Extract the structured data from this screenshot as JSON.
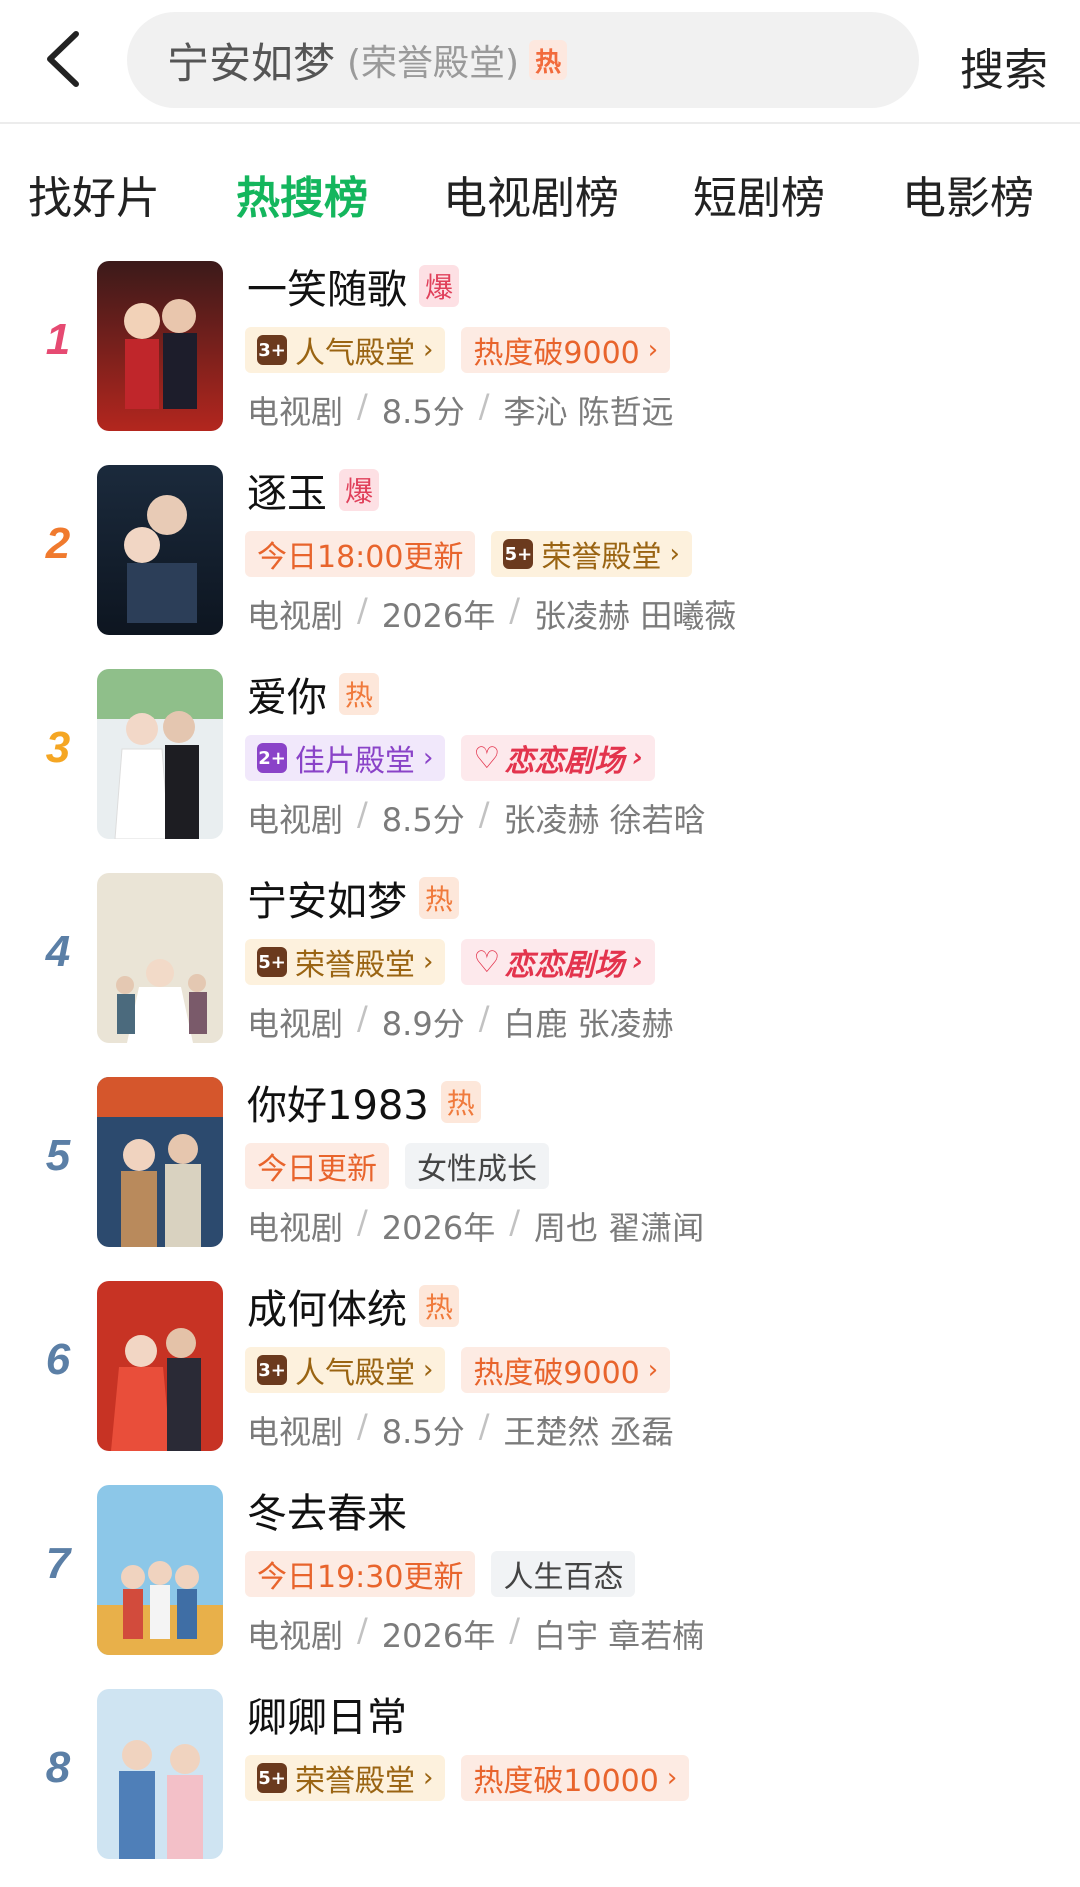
{
  "search": {
    "query": "宁安如梦",
    "query_sub": "(荣誉殿堂)",
    "hot_tag": "热",
    "submit_label": "搜索"
  },
  "tabs": [
    {
      "label": "找好片",
      "active": false
    },
    {
      "label": "热搜榜",
      "active": true
    },
    {
      "label": "电视剧榜",
      "active": false
    },
    {
      "label": "短剧榜",
      "active": false
    },
    {
      "label": "电影榜",
      "active": false
    }
  ],
  "colors": {
    "accent_green": "#14b65d",
    "rank_1": "#e64a72",
    "rank_2": "#f07a2e",
    "rank_3": "#f5a623",
    "rank_other": "#5b7fa6"
  },
  "list": [
    {
      "rank": "1",
      "title": "一笑随歌",
      "tag": "爆",
      "badges": [
        {
          "icon": "3+",
          "text": "人气殿堂",
          "arrow": "›"
        },
        {
          "icon": "",
          "text": "热度破9000",
          "arrow": "›"
        }
      ],
      "meta": {
        "type": "电视剧",
        "info": "8.5分",
        "cast": "李沁 陈哲远"
      }
    },
    {
      "rank": "2",
      "title": "逐玉",
      "tag": "爆",
      "badges": [
        {
          "icon": "",
          "text": "今日18:00更新",
          "arrow": ""
        },
        {
          "icon": "5+",
          "text": "荣誉殿堂",
          "arrow": "›"
        }
      ],
      "meta": {
        "type": "电视剧",
        "info": "2026年",
        "cast": "张凌赫 田曦薇"
      }
    },
    {
      "rank": "3",
      "title": "爱你",
      "tag": "热",
      "badges": [
        {
          "icon": "2+",
          "text": "佳片殿堂",
          "arrow": "›"
        },
        {
          "icon": "heart",
          "text": "恋恋剧场",
          "arrow": "›"
        }
      ],
      "meta": {
        "type": "电视剧",
        "info": "8.5分",
        "cast": "张凌赫 徐若晗"
      }
    },
    {
      "rank": "4",
      "title": "宁安如梦",
      "tag": "热",
      "badges": [
        {
          "icon": "5+",
          "text": "荣誉殿堂",
          "arrow": "›"
        },
        {
          "icon": "heart",
          "text": "恋恋剧场",
          "arrow": "›"
        }
      ],
      "meta": {
        "type": "电视剧",
        "info": "8.9分",
        "cast": "白鹿 张凌赫"
      }
    },
    {
      "rank": "5",
      "title": "你好1983",
      "tag": "热",
      "badges": [
        {
          "icon": "",
          "text": "今日更新",
          "arrow": ""
        },
        {
          "icon": "",
          "text": "女性成长",
          "arrow": ""
        }
      ],
      "meta": {
        "type": "电视剧",
        "info": "2026年",
        "cast": "周也 翟潇闻"
      }
    },
    {
      "rank": "6",
      "title": "成何体统",
      "tag": "热",
      "badges": [
        {
          "icon": "3+",
          "text": "人气殿堂",
          "arrow": "›"
        },
        {
          "icon": "",
          "text": "热度破9000",
          "arrow": "›"
        }
      ],
      "meta": {
        "type": "电视剧",
        "info": "8.5分",
        "cast": "王楚然 丞磊"
      }
    },
    {
      "rank": "7",
      "title": "冬去春来",
      "tag": "",
      "badges": [
        {
          "icon": "",
          "text": "今日19:30更新",
          "arrow": ""
        },
        {
          "icon": "",
          "text": "人生百态",
          "arrow": ""
        }
      ],
      "meta": {
        "type": "电视剧",
        "info": "2026年",
        "cast": "白宇 章若楠"
      }
    },
    {
      "rank": "8",
      "title": "卿卿日常",
      "tag": "",
      "badges": [
        {
          "icon": "5+",
          "text": "荣誉殿堂",
          "arrow": "›"
        },
        {
          "icon": "",
          "text": "热度破10000",
          "arrow": "›"
        }
      ],
      "meta": {
        "type": "",
        "info": "",
        "cast": ""
      }
    }
  ]
}
